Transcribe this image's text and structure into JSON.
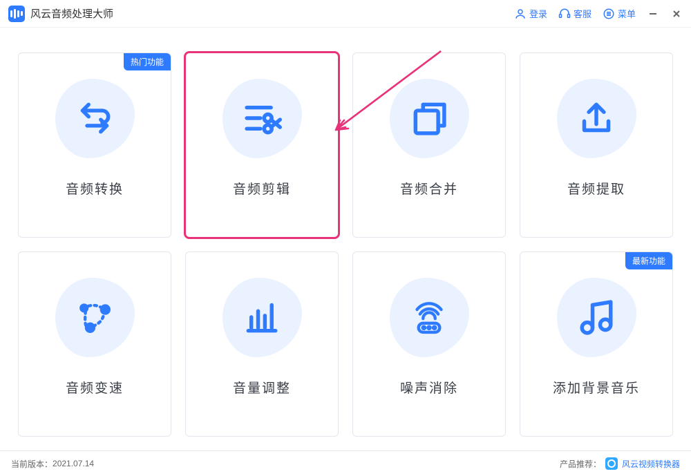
{
  "app": {
    "title": "风云音频处理大师"
  },
  "titlebar": {
    "login": "登录",
    "support": "客服",
    "menu": "菜单"
  },
  "badges": {
    "hot": "热门功能",
    "new": "最新功能"
  },
  "cards": [
    {
      "label": "音频转换",
      "icon": "convert"
    },
    {
      "label": "音频剪辑",
      "icon": "cut"
    },
    {
      "label": "音频合并",
      "icon": "merge"
    },
    {
      "label": "音频提取",
      "icon": "extract"
    },
    {
      "label": "音频变速",
      "icon": "speed"
    },
    {
      "label": "音量调整",
      "icon": "volume"
    },
    {
      "label": "噪声消除",
      "icon": "denoise"
    },
    {
      "label": "添加背景音乐",
      "icon": "bgm"
    }
  ],
  "footer": {
    "version_label": "当前版本：",
    "version": "2021.07.14",
    "promo_label": "产品推荐：",
    "promo_product": "风云视频转换器"
  },
  "colors": {
    "accent": "#2f7bff",
    "highlight": "#e8337a",
    "blob": "#eaf2ff"
  }
}
